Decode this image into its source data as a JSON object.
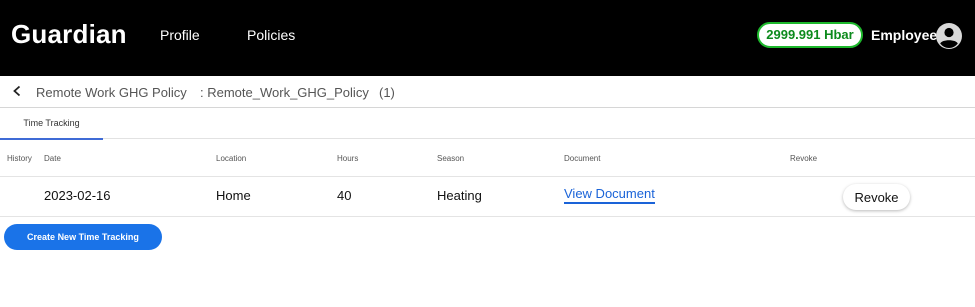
{
  "header": {
    "brand": "Guardian",
    "nav": [
      "Profile",
      "Policies"
    ],
    "balance": "2999.991 Hbar",
    "role": "Employee"
  },
  "breadcrumb": {
    "policy_name": "Remote Work GHG Policy",
    "policy_id": ": Remote_Work_GHG_Policy",
    "count": "(1)"
  },
  "tabs": [
    "Time Tracking"
  ],
  "table": {
    "columns": [
      "History",
      "Date",
      "Location",
      "Hours",
      "Season",
      "Document",
      "Revoke"
    ],
    "rows": [
      {
        "date": "2023-02-16",
        "location": "Home",
        "hours": "40",
        "season": "Heating",
        "document": "View Document",
        "revoke": "Revoke"
      }
    ]
  },
  "actions": {
    "create_label": "Create New Time Tracking"
  },
  "colors": {
    "header_bg": "#000000",
    "balance_border": "#1db82c",
    "accent": "#1a73e8",
    "tab_underline": "#3f6bd6"
  },
  "icons": {
    "avatar": "account-circle-icon",
    "back": "chevron-left-icon"
  }
}
